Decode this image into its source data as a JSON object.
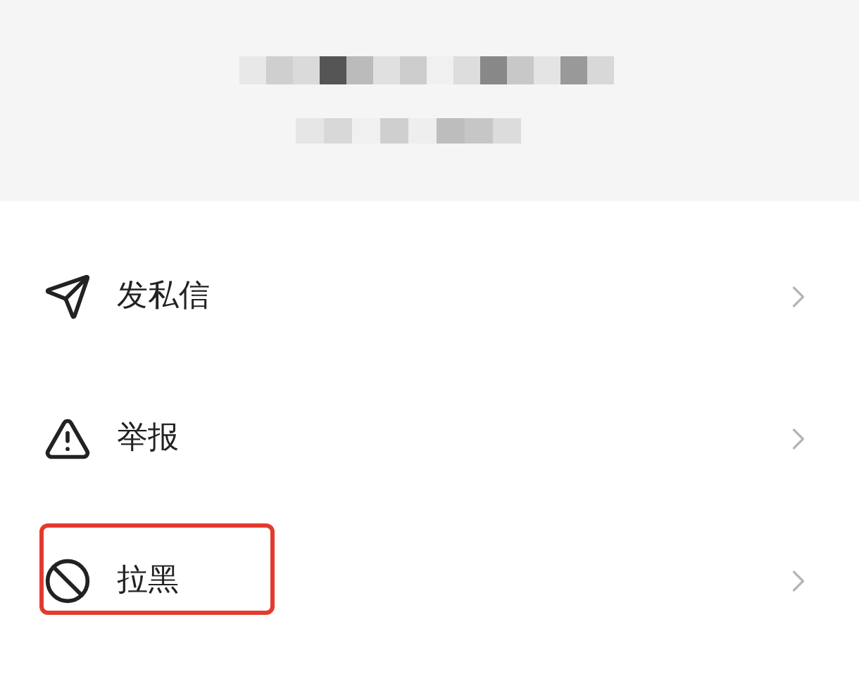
{
  "header": {
    "redacted": true
  },
  "menu": [
    {
      "label": "发私信",
      "kind": "send",
      "highlighted": false
    },
    {
      "label": "举报",
      "kind": "warning",
      "highlighted": false
    },
    {
      "label": "拉黑",
      "kind": "block",
      "highlighted": true
    }
  ]
}
